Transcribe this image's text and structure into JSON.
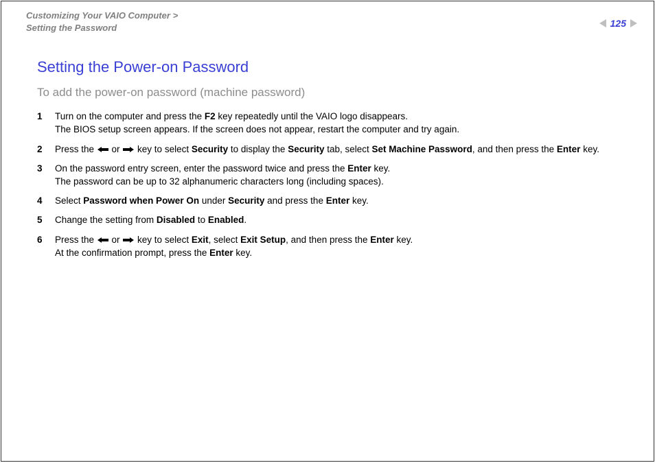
{
  "header": {
    "breadcrumb1": "Customizing Your VAIO Computer",
    "caret": ">",
    "breadcrumb2": "Setting the Password",
    "page_number": "125"
  },
  "title": "Setting the Power-on Password",
  "subtitle": "To add the power-on password (machine password)",
  "steps": {
    "s1": {
      "num": "1",
      "t1a": "Turn on the computer and press the ",
      "t1b": "F2",
      "t1c": " key repeatedly until the VAIO logo disappears.",
      "t2": "The BIOS setup screen appears. If the screen does not appear, restart the computer and try again."
    },
    "s2": {
      "num": "2",
      "t1a": "Press the ",
      "or": " or ",
      "t1b": " key to select ",
      "sec": "Security",
      "t1c": " to display the ",
      "t1d": " tab, select ",
      "smp": "Set Machine Password",
      "t1e": ", and then press the ",
      "enter": "Enter",
      "t1f": " key."
    },
    "s3": {
      "num": "3",
      "t1a": "On the password entry screen, enter the password twice and press the ",
      "enter": "Enter",
      "t1b": " key.",
      "t2": "The password can be up to 32 alphanumeric characters long (including spaces)."
    },
    "s4": {
      "num": "4",
      "t1a": "Select ",
      "pw": "Password when Power On",
      "t1b": " under ",
      "sec": "Security",
      "t1c": " and press the ",
      "enter": "Enter",
      "t1d": " key."
    },
    "s5": {
      "num": "5",
      "t1a": "Change the setting from ",
      "dis": "Disabled",
      "t1b": " to ",
      "en": "Enabled",
      "t1c": "."
    },
    "s6": {
      "num": "6",
      "t1a": "Press the ",
      "or": " or ",
      "t1b": " key to select ",
      "exit": "Exit",
      "t1c": ", select ",
      "exitsetup": "Exit Setup",
      "t1d": ", and then press the ",
      "enter": "Enter",
      "t1e": " key.",
      "t2a": "At the confirmation prompt, press the ",
      "t2b": " key."
    }
  }
}
